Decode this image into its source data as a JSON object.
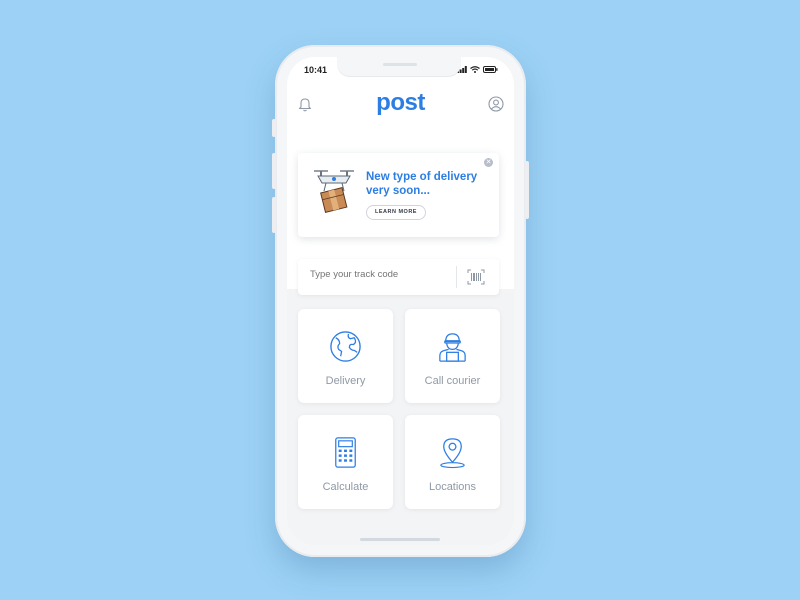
{
  "status_bar": {
    "time": "10:41"
  },
  "header": {
    "logo": "post",
    "bell_icon": "bell-icon",
    "profile_icon": "user-icon"
  },
  "promo": {
    "title": "New type of delivery very soon...",
    "button": "LEARN MORE",
    "illustration": "drone-delivery-icon",
    "close_icon": "close-icon"
  },
  "track": {
    "placeholder": "Type your track code",
    "scan_icon": "barcode-icon"
  },
  "tiles": [
    {
      "label": "Delivery",
      "icon": "globe-icon"
    },
    {
      "label": "Call courier",
      "icon": "courier-icon"
    },
    {
      "label": "Calculate",
      "icon": "calculator-icon"
    },
    {
      "label": "Locations",
      "icon": "location-pin-icon"
    }
  ],
  "colors": {
    "background": "#9dd2f6",
    "accent": "#2d7ee3",
    "muted": "#8f99a6"
  }
}
